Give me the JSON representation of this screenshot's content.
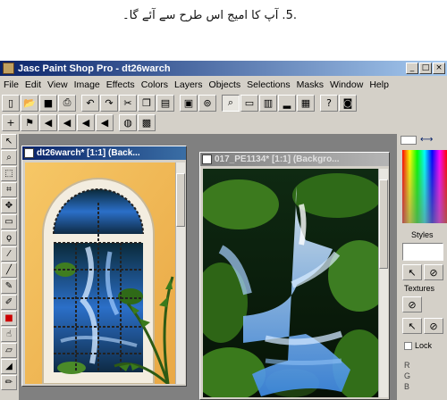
{
  "caption": ".5. آپ کا امیج اس طرح سے آئے گا۔",
  "window": {
    "title": "Jasc Paint Shop Pro - dt26warch",
    "controls": [
      "_",
      "□",
      "×"
    ]
  },
  "menu": [
    "File",
    "Edit",
    "View",
    "Image",
    "Effects",
    "Colors",
    "Layers",
    "Objects",
    "Selections",
    "Masks",
    "Window",
    "Help"
  ],
  "toolbar_row1": [
    "new-file-icon",
    "open-icon",
    "save-icon",
    "print-icon",
    "undo-icon",
    "redo-icon",
    "cut-icon",
    "copy-icon",
    "paste-icon",
    "browse-icon",
    "scanner-icon",
    "zoom-icon",
    "overview-icon",
    "palette-icon",
    "histogram-icon",
    "layers-icon",
    "help-icon",
    "tool-options-icon"
  ],
  "toolbar_row2": [
    "crosshair-icon",
    "flag-icon",
    "arrow-left-icon",
    "arrow-left-2-icon",
    "arrow-left-3-icon",
    "arrow-left-4-icon",
    "globe-icon",
    "gray-icon"
  ],
  "tools": [
    "arrow-tool",
    "zoom-tool",
    "deform-tool",
    "crop-tool",
    "mover-tool",
    "selection-tool",
    "freehand-tool",
    "magic-wand-tool",
    "dropper-tool",
    "paintbrush-tool",
    "clone-tool",
    "color-replacer-tool",
    "retouch-tool",
    "eraser-tool",
    "fill-tool",
    "text-tool"
  ],
  "documents": [
    {
      "title": "dt26warch* [1:1] (Back...",
      "active": true
    },
    {
      "title": "017_PE1134* [1:1] (Backgro...",
      "active": false
    }
  ],
  "panel": {
    "styles_label": "Styles",
    "textures_label": "Textures",
    "lock_label": "Lock",
    "rgb": [
      "R",
      "G",
      "B"
    ],
    "swap_arrow": "⟷"
  },
  "colors": {
    "titlebar": "#0a246a",
    "chrome": "#d4d0c8",
    "workspace": "#808080",
    "water": "#1e6fd8",
    "moss": "#3f7d20",
    "wall": "#f5c060"
  }
}
